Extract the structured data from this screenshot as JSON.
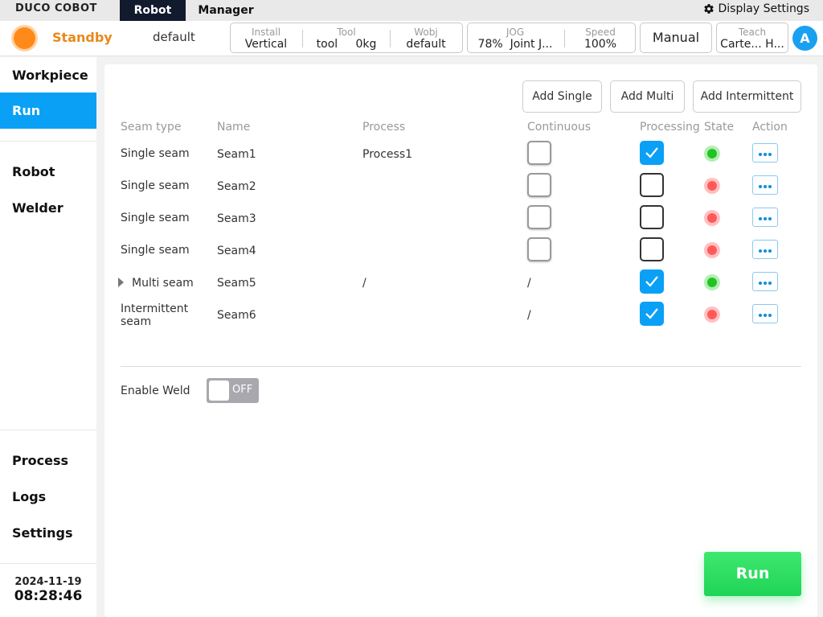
{
  "app": {
    "logo": "DUCO COBOT",
    "tabs": [
      {
        "label": "Robot",
        "active": true
      },
      {
        "label": "Manager",
        "active": false
      }
    ],
    "display_settings": "Display Settings"
  },
  "status": {
    "state": "Standby",
    "state_color": "#ff8a1a",
    "project": "default",
    "install": {
      "label": "Install",
      "value": "Vertical"
    },
    "tool": {
      "label": "Tool",
      "value": "tool",
      "payload": "0kg"
    },
    "wobj": {
      "label": "Wobj",
      "value": "default"
    },
    "jog": {
      "label": "JOG",
      "percent": "78%",
      "mode": "Joint J..."
    },
    "speed": {
      "label": "Speed",
      "value": "100%"
    },
    "mode_button": "Manual",
    "teach": {
      "label": "Teach",
      "value": "Carte... H..."
    },
    "avatar": "A"
  },
  "sidebar": {
    "items": [
      {
        "label": "Workpiece",
        "active": false
      },
      {
        "label": "Run",
        "active": true
      },
      {
        "label": "Robot",
        "active": false
      },
      {
        "label": "Welder",
        "active": false
      },
      {
        "label": "Process",
        "active": false
      },
      {
        "label": "Logs",
        "active": false
      },
      {
        "label": "Settings",
        "active": false
      }
    ],
    "date": "2024-11-19",
    "time": "08:28:46"
  },
  "toolbar": {
    "add_single": "Add Single",
    "add_multi": "Add Multi",
    "add_intermittent": "Add Intermittent"
  },
  "table": {
    "headers": {
      "seam_type": "Seam type",
      "name": "Name",
      "process": "Process",
      "continuous": "Continuous",
      "processing": "Processing",
      "state": "State",
      "action": "Action"
    },
    "rows": [
      {
        "seam_type": "Single seam",
        "name": "Seam1",
        "process": "Process1",
        "continuous": "unchecked",
        "processing": true,
        "state": "green"
      },
      {
        "seam_type": "Single seam",
        "name": "Seam2",
        "process": "",
        "continuous": "unchecked",
        "processing": false,
        "state": "red"
      },
      {
        "seam_type": "Single seam",
        "name": "Seam3",
        "process": "",
        "continuous": "unchecked",
        "processing": false,
        "state": "red"
      },
      {
        "seam_type": "Single seam",
        "name": "Seam4",
        "process": "",
        "continuous": "unchecked",
        "processing": false,
        "state": "red"
      },
      {
        "seam_type": "Multi seam",
        "name": "Seam5",
        "process": "/",
        "continuous": "/",
        "processing": true,
        "state": "green",
        "expandable": true
      },
      {
        "seam_type": "Intermittent seam",
        "name": "Seam6",
        "process": "",
        "continuous": "/",
        "processing": true,
        "state": "red"
      }
    ]
  },
  "enable_weld": {
    "label": "Enable Weld",
    "value": "OFF"
  },
  "run_button": "Run",
  "colors": {
    "accent": "#0aa0f5",
    "nav_dark": "#121a2e",
    "run_green": "#28dc64",
    "state_green": "#22c322",
    "state_red": "#ff5a5a"
  }
}
